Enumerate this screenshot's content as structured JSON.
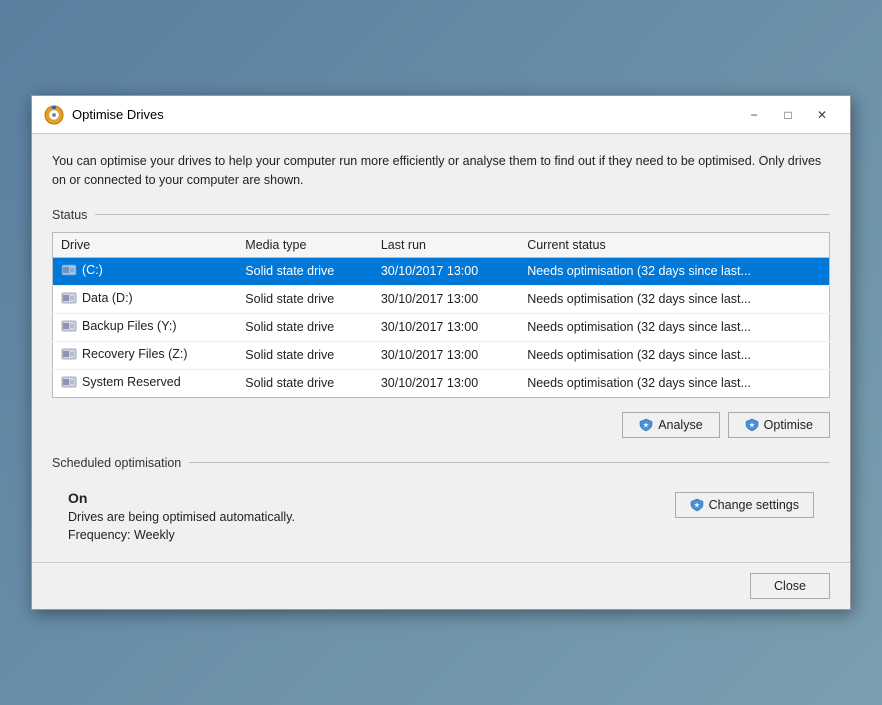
{
  "window": {
    "title": "Optimise Drives",
    "description": "You can optimise your drives to help your computer run more efficiently or analyse them to find out if they need to be optimised. Only drives on or connected to your computer are shown.",
    "status_label": "Status",
    "scheduled_label": "Scheduled optimisation",
    "columns": [
      "Drive",
      "Media type",
      "Last run",
      "Current status"
    ],
    "drives": [
      {
        "name": "(C:)",
        "type": "Solid state drive",
        "last_run": "30/10/2017 13:00",
        "status": "Needs optimisation (32 days since last...",
        "selected": true
      },
      {
        "name": "Data (D:)",
        "type": "Solid state drive",
        "last_run": "30/10/2017 13:00",
        "status": "Needs optimisation (32 days since last...",
        "selected": false
      },
      {
        "name": "Backup Files (Y:)",
        "type": "Solid state drive",
        "last_run": "30/10/2017 13:00",
        "status": "Needs optimisation (32 days since last...",
        "selected": false
      },
      {
        "name": "Recovery Files (Z:)",
        "type": "Solid state drive",
        "last_run": "30/10/2017 13:00",
        "status": "Needs optimisation (32 days since last...",
        "selected": false
      },
      {
        "name": "System Reserved",
        "type": "Solid state drive",
        "last_run": "30/10/2017 13:00",
        "status": "Needs optimisation (32 days since last...",
        "selected": false
      }
    ],
    "analyse_label": "Analyse",
    "optimise_label": "Optimise",
    "scheduled": {
      "status": "On",
      "description": "Drives are being optimised automatically.",
      "frequency": "Frequency: Weekly",
      "change_settings_label": "Change settings"
    },
    "close_label": "Close"
  }
}
